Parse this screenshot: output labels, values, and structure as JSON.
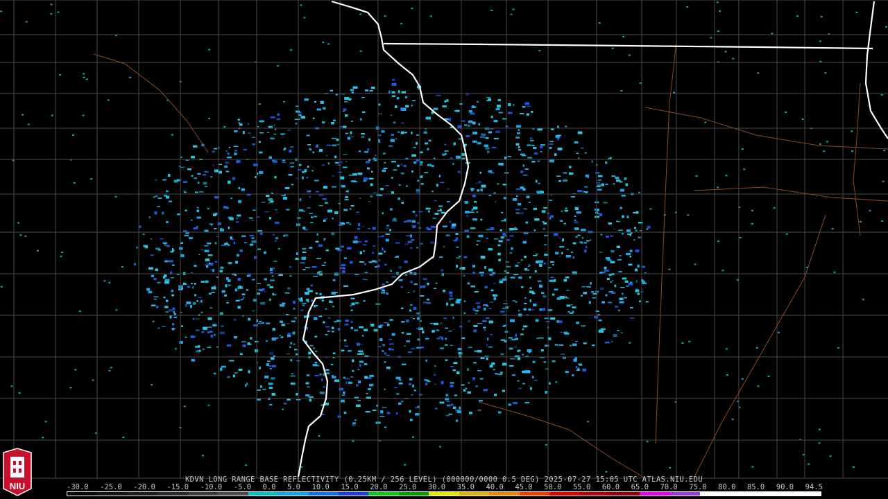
{
  "product": {
    "caption": "KDVN LONG RANGE BASE REFLECTIVITY (0.25KM / 256 LEVEL) (000000/0000 0.5 DEG) 2025-07-27 15:05 UTC  ATLAS.NIU.EDU",
    "radar_site": "KDVN",
    "elevation_deg": "0.5 DEG",
    "timestamp": "2025-07-27 15:05 UTC",
    "source": "ATLAS.NIU.EDU"
  },
  "logo": {
    "text": "NIU",
    "colors": {
      "primary": "#c8102e",
      "secondary": "#ffffff"
    }
  },
  "color_scale": {
    "labels": [
      "-30.0",
      "-25.0",
      "-20.0",
      "-15.0",
      "-10.0",
      "-5.0",
      "0.0",
      "5.0",
      "10.0",
      "15.0",
      "20.0",
      "25.0",
      "30.0",
      "35.0",
      "40.0",
      "45.0",
      "50.0",
      "55.0",
      "60.0",
      "65.0",
      "70.0",
      "75.0",
      "80.0",
      "85.0",
      "90.0",
      "94.5"
    ],
    "colors": [
      "#0a0a0a",
      "#141414",
      "#1e1e1e",
      "#2a2a2a",
      "#3a3a3a",
      "#4a4a4a",
      "#07c1c9",
      "#11a6e0",
      "#1b6fe8",
      "#1e3ee0",
      "#10c81a",
      "#0a9a10",
      "#e6e600",
      "#e0b400",
      "#e88a00",
      "#f04000",
      "#e00000",
      "#b00000",
      "#8a0000",
      "#e800e8",
      "#9c3cd6",
      "#ffffff",
      "#ffffff",
      "#ffffff",
      "#ffffff"
    ]
  },
  "map_colors": {
    "background": "#000000",
    "state_border": "#ffffff",
    "county_lines": "#4a4a4a",
    "highways": "#8b4a2a",
    "echo_light": "#2bc6e0",
    "echo_mid": "#1fa8e6",
    "echo_dark": "#1e5adc",
    "radar_site_marker": "#000000"
  }
}
